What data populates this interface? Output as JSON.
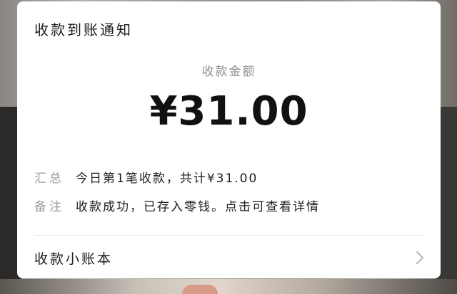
{
  "notification": {
    "title": "收款到账通知",
    "amount_label": "收款金额",
    "amount": "¥31.00",
    "summary": {
      "key": "汇总",
      "value": "今日第1笔收款，共计¥31.00"
    },
    "remark": {
      "key": "备注",
      "value": "收款成功，已存入零钱。点击可查看详情"
    },
    "ledger_link": {
      "label": "收款小账本",
      "icon": "chevron-right-icon"
    }
  },
  "colors": {
    "card_bg": "#ffffff",
    "muted_text": "#9a9a9a",
    "primary_text": "#1e1e1e"
  }
}
